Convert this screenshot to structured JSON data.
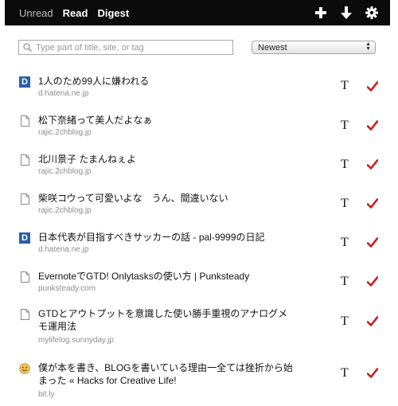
{
  "nav": {
    "tabs": [
      {
        "label": "Unread"
      },
      {
        "label": "Read"
      },
      {
        "label": "Digest"
      }
    ],
    "icons": [
      "add-icon",
      "download-arrow-icon",
      "gear-icon"
    ]
  },
  "search": {
    "placeholder": "Type part of title, site, or tag",
    "value": ""
  },
  "sort": {
    "selected": "Newest"
  },
  "colors": {
    "topbar": "#0b0b0b",
    "check": "#cc1b1b",
    "site_text": "#8e8e8e",
    "d_icon": "#2a5ea8"
  },
  "items": [
    {
      "title": "1人のため99人に嫌われる",
      "site": "d.hatena.ne.jp",
      "icon": "hatena-d-icon",
      "icon_text": "D",
      "mark": "T"
    },
    {
      "title": "松下奈緒って美人だよなぁ",
      "site": "rajic.2chblog.jp",
      "icon": "document-icon",
      "mark": "T"
    },
    {
      "title": "北川景子 たまんねぇよ",
      "site": "rajic.2chblog.jp",
      "icon": "document-icon",
      "mark": "T"
    },
    {
      "title": "柴咲コウって可愛いよな　うん、間違いない",
      "site": "rajic.2chblog.jp",
      "icon": "document-icon",
      "mark": "T"
    },
    {
      "title": "日本代表が目指すべきサッカーの話 - pal-9999の日記",
      "site": "d.hatena.ne.jp",
      "icon": "hatena-d-icon",
      "icon_text": "D",
      "mark": "T"
    },
    {
      "title": "EvernoteでGTD! Onlytasksの使い方 | Punksteady",
      "site": "punksteady.com",
      "icon": "document-icon",
      "mark": "T"
    },
    {
      "title": "GTDとアウトプットを意識した使い勝手重視のアナログメモ運用法",
      "site": "mylifelog.sunnyday.jp",
      "icon": "document-icon",
      "mark": "T"
    },
    {
      "title": "僕が本を書き、BLOGを書いている理由一全ては挫折から始まった « Hacks for Creative Life!",
      "site": "bit.ly",
      "icon": "smiley-face-icon",
      "mark": "T"
    }
  ]
}
